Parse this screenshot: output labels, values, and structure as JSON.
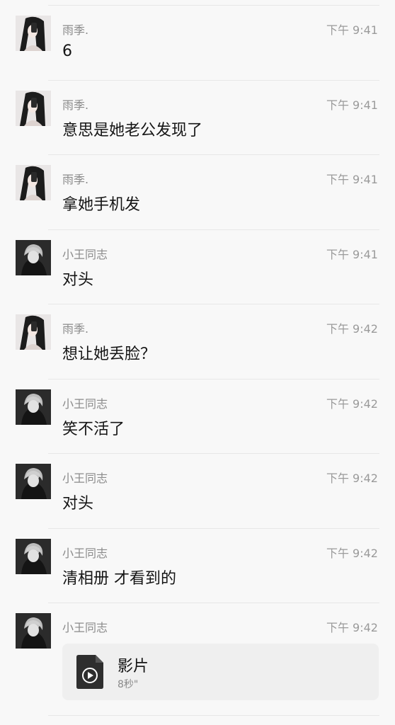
{
  "messages": [
    {
      "sender": "雨季.",
      "time": "下午 9:41",
      "text": "6",
      "avatar": "girl-avatar"
    },
    {
      "sender": "雨季.",
      "time": "下午 9:41",
      "text": "意思是她老公发现了",
      "avatar": "girl-avatar"
    },
    {
      "sender": "雨季.",
      "time": "下午 9:41",
      "text": "拿她手机发",
      "avatar": "girl-avatar"
    },
    {
      "sender": "小王同志",
      "time": "下午 9:41",
      "text": "对头",
      "avatar": "boy-avatar"
    },
    {
      "sender": "雨季.",
      "time": "下午 9:42",
      "text": "想让她丢脸？",
      "avatar": "girl-avatar"
    },
    {
      "sender": "小王同志",
      "time": "下午 9:42",
      "text": "笑不活了",
      "avatar": "boy-avatar"
    },
    {
      "sender": "小王同志",
      "time": "下午 9:42",
      "text": "对头",
      "avatar": "boy-avatar"
    },
    {
      "sender": "小王同志",
      "time": "下午 9:42",
      "text": "清相册 才看到的",
      "avatar": "boy-avatar"
    },
    {
      "sender": "小王同志",
      "time": "下午 9:42",
      "text": "",
      "avatar": "boy-avatar"
    }
  ],
  "video": {
    "title": "影片",
    "duration": "8秒\"",
    "icon": "video-file-icon"
  },
  "colors": {
    "background": "#f8f8f8",
    "text": "#151515",
    "meta": "#8a8a8a",
    "card": "#efefef"
  }
}
